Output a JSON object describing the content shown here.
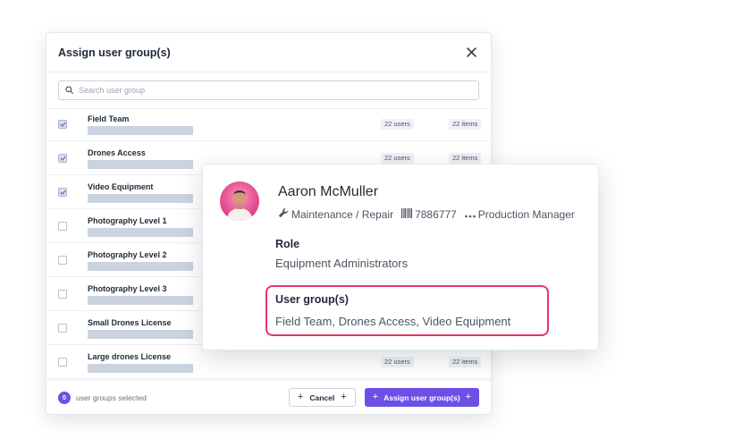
{
  "modal": {
    "title": "Assign user group(s)",
    "search_placeholder": "Search user group",
    "rows": [
      {
        "title": "Field Team",
        "checked": true,
        "users": "22 users",
        "items": "22 items"
      },
      {
        "title": "Drones Access",
        "checked": true,
        "users": "22 users",
        "items": "22 items"
      },
      {
        "title": "Video Equipment",
        "checked": true
      },
      {
        "title": "Photography Level 1",
        "checked": false
      },
      {
        "title": "Photography Level 2",
        "checked": false
      },
      {
        "title": "Photography Level 3",
        "checked": false
      },
      {
        "title": "Small Drones License",
        "checked": false
      },
      {
        "title": "Large drones License",
        "checked": false,
        "users": "22 users",
        "items": "22 items"
      }
    ],
    "footer": {
      "selected_count": "0",
      "selected_label": "user groups selected",
      "cancel_label": "Cancel",
      "assign_label": "Assign user group(s)"
    }
  },
  "profile": {
    "name": "Aaron McMuller",
    "department": "Maintenance / Repair",
    "barcode": "7886777",
    "position": "Production Manager",
    "role_label": "Role",
    "role_value": "Equipment Administrators",
    "groups_label": "User group(s)",
    "groups_value": "Field Team,  Drones Access, Video Equipment"
  },
  "colors": {
    "accent": "#6d4fe6",
    "highlight": "#e8336d",
    "placeholder_bar": "#cbd3e0"
  },
  "icons": {
    "search": "search-icon",
    "close": "close-icon",
    "department": "wrench-icon",
    "barcode": "barcode-icon",
    "position": "ellipsis-icon"
  }
}
